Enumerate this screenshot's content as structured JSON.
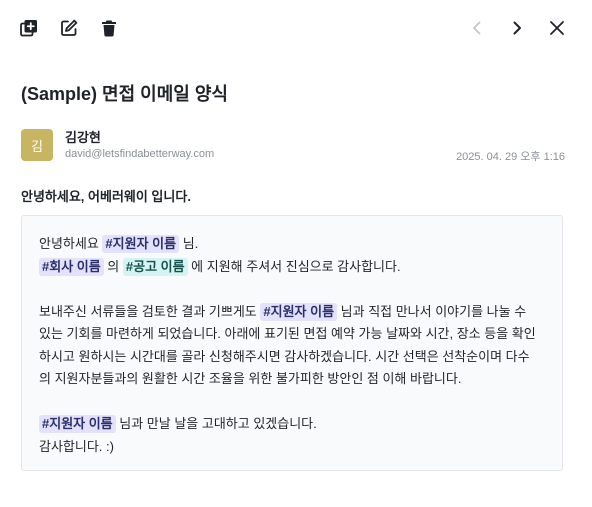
{
  "toolbar": {
    "left_icons": [
      "duplicate-icon",
      "edit-icon",
      "trash-icon"
    ],
    "right_icons": [
      "chevron-left-icon",
      "chevron-right-icon",
      "close-icon"
    ]
  },
  "email": {
    "title": "(Sample) 면접 이메일 양식",
    "avatar_initial": "김",
    "avatar_color": "#c8b561",
    "sender_name": "김강현",
    "sender_email": "david@letsfindabetterway.com",
    "date": "2025. 04. 29 오후 1:16",
    "greeting": "안녕하세요, 어베러웨이 입니다."
  },
  "body": {
    "l1_pre": "안녕하세요 ",
    "l1_tag": "#지원자 이름",
    "l1_post": " 님.",
    "l2_tag1": "#회사 이름",
    "l2_mid": " 의 ",
    "l2_tag2": "#공고 이름",
    "l2_post": " 에 지원해 주셔서 진심으로 감사합니다.",
    "p2_pre": "보내주신 서류들을 검토한 결과 기쁘게도 ",
    "p2_tag": "#지원자 이름",
    "p2_line1_post": " 님과 직접 만나서 이야기를 나눌 수",
    "p2_line2": "있는 기회를 마련하게 되었습니다. 아래에 표기된 면접 예약 가능 날짜와 시간, 장소 등을 확인",
    "p2_line3": "하시고 원하시는 시간대를 골라 신청해주시면 감사하겠습니다. 시간 선택은 선착순이며 다수",
    "p2_line4": "의 지원자분들과의 원활한 시간 조율을 위한 불가피한 방안인 점 이해 바랍니다.",
    "p3_tag": "#지원자 이름",
    "p3_post": " 님과 만날 날을 고대하고 있겠습니다.",
    "p3_line2": "감사합니다. :)"
  },
  "colors": {
    "tag_purple_bg": "#e3e1fb",
    "tag_teal_bg": "#d5f3f2"
  }
}
